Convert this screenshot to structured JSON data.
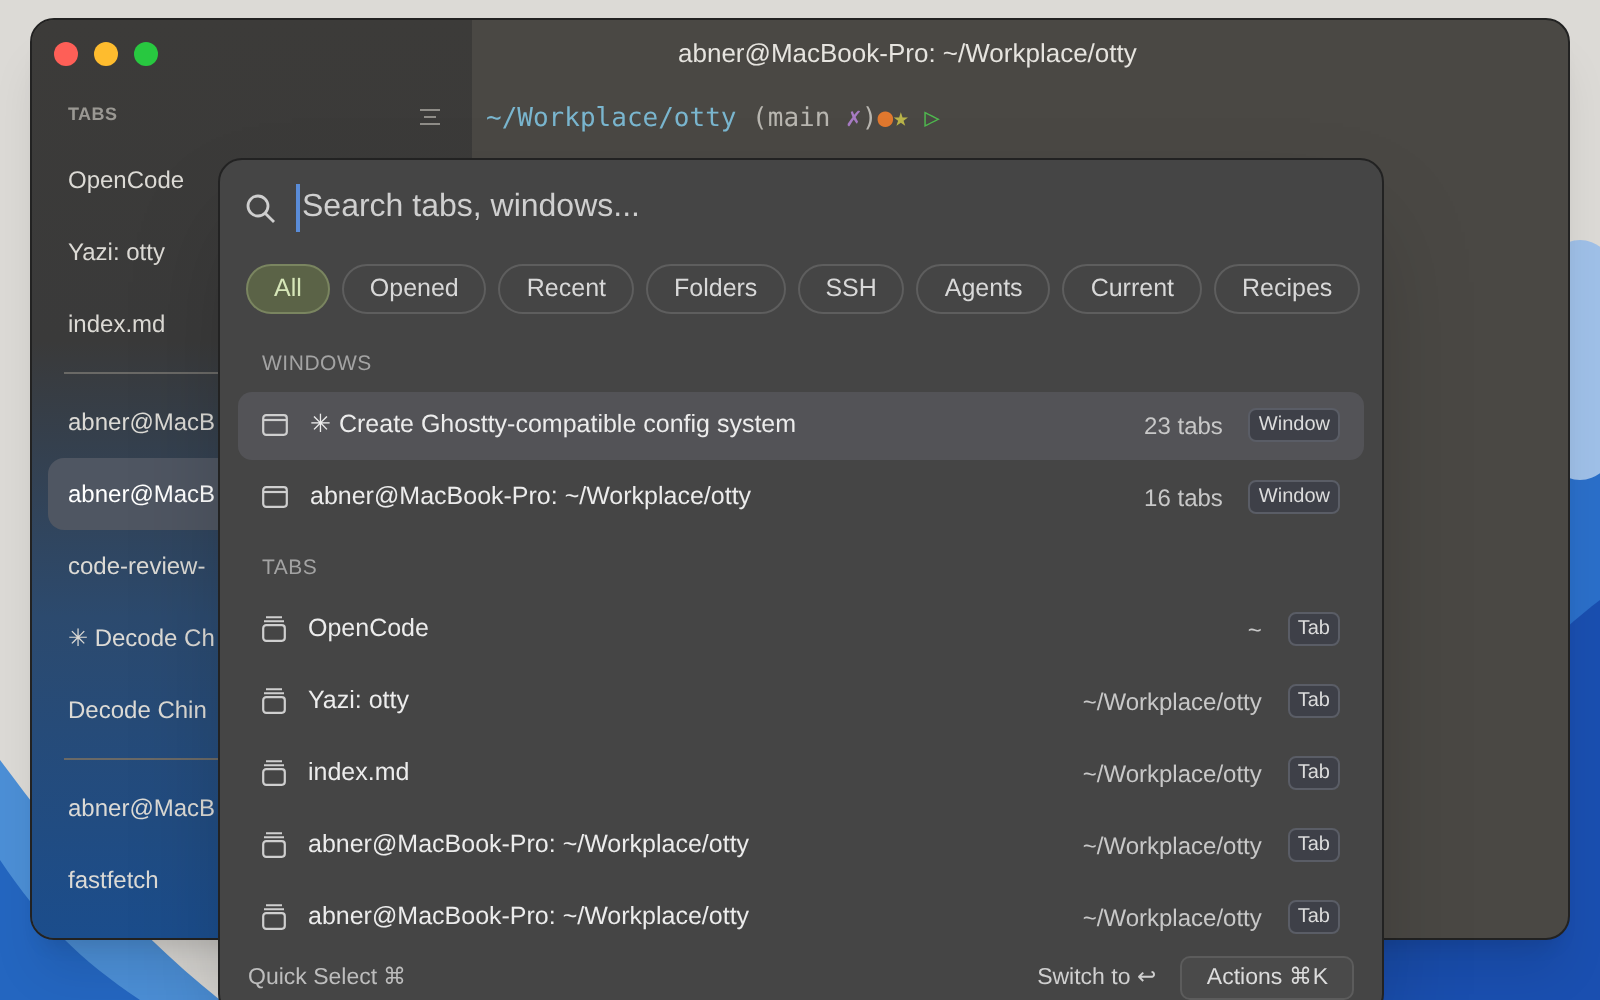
{
  "window": {
    "title": "abner@MacBook-Pro: ~/Workplace/otty"
  },
  "sidebar": {
    "heading": "TABS",
    "groups": [
      [
        {
          "label": "OpenCode",
          "selected": false
        },
        {
          "label": "Yazi: otty",
          "selected": false
        },
        {
          "label": "index.md",
          "selected": false
        }
      ],
      [
        {
          "label": "abner@MacB",
          "selected": false
        },
        {
          "label": "abner@MacB",
          "selected": true
        },
        {
          "label": "code-review-",
          "selected": false
        },
        {
          "label": "✳ Decode Ch",
          "selected": false
        },
        {
          "label": "Decode Chin",
          "selected": false
        }
      ],
      [
        {
          "label": "abner@MacB",
          "selected": false
        },
        {
          "label": "fastfetch",
          "selected": false
        }
      ]
    ]
  },
  "terminal": {
    "prompt": [
      {
        "text": "~/Workplace/otty",
        "color": "#7ab6cf"
      },
      {
        "text": " (main ",
        "color": "#b8b6b0"
      },
      {
        "text": "✗",
        "color": "#a77bc4"
      },
      {
        "text": ")",
        "color": "#b8b6b0"
      },
      {
        "text": "●",
        "color": "#e0782e"
      },
      {
        "text": "★",
        "color": "#b9b44a"
      },
      {
        "text": " ▷",
        "color": "#4fb84f"
      }
    ]
  },
  "palette": {
    "search": {
      "placeholder": "Search tabs, windows..."
    },
    "filters": [
      {
        "label": "All",
        "selected": true
      },
      {
        "label": "Opened",
        "selected": false
      },
      {
        "label": "Recent",
        "selected": false
      },
      {
        "label": "Folders",
        "selected": false
      },
      {
        "label": "SSH",
        "selected": false
      },
      {
        "label": "Agents",
        "selected": false
      },
      {
        "label": "Current",
        "selected": false
      },
      {
        "label": "Recipes",
        "selected": false
      }
    ],
    "sections": [
      {
        "heading": "WINDOWS",
        "items": [
          {
            "kind": "window",
            "title": "✳ Create Ghostty-compatible config system",
            "detail": "23 tabs",
            "badge": "Window",
            "selected": true
          },
          {
            "kind": "window",
            "title": "abner@MacBook-Pro: ~/Workplace/otty",
            "detail": "16 tabs",
            "badge": "Window",
            "selected": false
          }
        ]
      },
      {
        "heading": "TABS",
        "items": [
          {
            "kind": "tab",
            "title": "OpenCode",
            "detail": "~",
            "badge": "Tab",
            "selected": false
          },
          {
            "kind": "tab",
            "title": "Yazi: otty",
            "detail": "~/Workplace/otty",
            "badge": "Tab",
            "selected": false
          },
          {
            "kind": "tab",
            "title": "index.md",
            "detail": "~/Workplace/otty",
            "badge": "Tab",
            "selected": false
          },
          {
            "kind": "tab",
            "title": "abner@MacBook-Pro: ~/Workplace/otty",
            "detail": "~/Workplace/otty",
            "badge": "Tab",
            "selected": false
          },
          {
            "kind": "tab",
            "title": "abner@MacBook-Pro: ~/Workplace/otty",
            "detail": "~/Workplace/otty",
            "badge": "Tab",
            "selected": false
          }
        ]
      }
    ],
    "footer": {
      "hint": "Quick Select ⌘",
      "switch": "Switch to ↩",
      "actions": "Actions ⌘K"
    }
  }
}
